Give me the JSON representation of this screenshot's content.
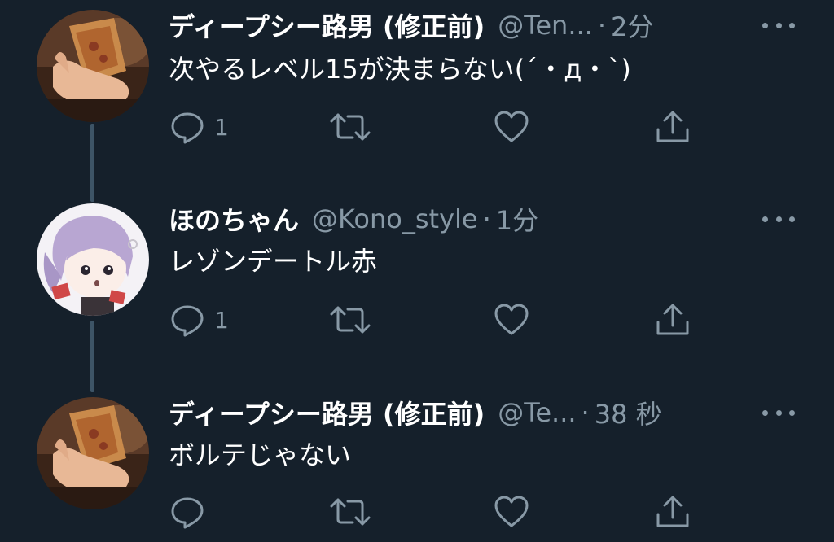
{
  "colors": {
    "background": "#15202b",
    "text_primary": "#ffffff",
    "text_secondary": "#8899a6",
    "thread_line": "#3d5466"
  },
  "tweets": [
    {
      "display_name": "ディープシー路男 (修正前)",
      "handle": "@Ten...",
      "separator": "·",
      "time": "2分",
      "text": "次やるレベル15が決まらない(´・д・`)",
      "reply_count": "1",
      "avatar_icon": "hand-holding-pizza-photo"
    },
    {
      "display_name": "ほのちゃん",
      "handle": "@Kono_style",
      "separator": "·",
      "time": "1分",
      "text": "レゾンデートル赤",
      "reply_count": "1",
      "avatar_icon": "anime-character-illustration"
    },
    {
      "display_name": "ディープシー路男 (修正前)",
      "handle": "@Te...",
      "separator": "·",
      "time": "38 秒",
      "text": "ボルテじゃない",
      "reply_count": "",
      "avatar_icon": "hand-holding-pizza-photo"
    }
  ],
  "action_icons": [
    "reply-icon",
    "retweet-icon",
    "like-icon",
    "share-icon"
  ],
  "menu_icon": "more-options-icon"
}
